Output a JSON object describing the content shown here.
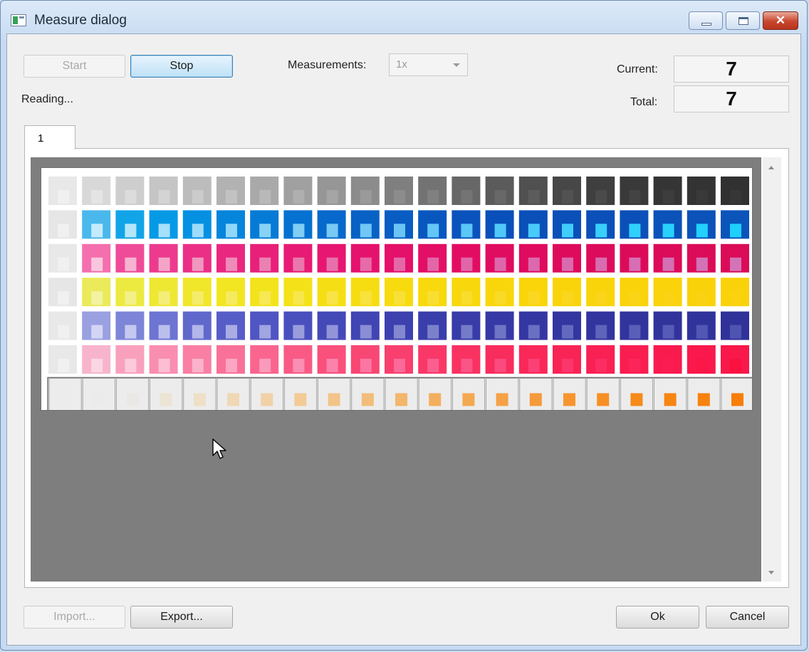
{
  "window": {
    "title": "Measure dialog",
    "icon": "app-window-icon",
    "close_glyph": "✕"
  },
  "controls": {
    "start_label": "Start",
    "stop_label": "Stop",
    "measurements_label": "Measurements:",
    "measurements_value": "1x",
    "status": "Reading...",
    "current_label": "Current:",
    "current_value": "7",
    "total_label": "Total:",
    "total_value": "7"
  },
  "tabs": [
    {
      "label": "1"
    }
  ],
  "footer": {
    "import_label": "Import...",
    "export_label": "Export...",
    "ok_label": "Ok",
    "cancel_label": "Cancel"
  },
  "colors": {
    "viewport_bg": "#7e7e7e",
    "accent_button": "#bfe1f7"
  },
  "patch_chart": {
    "columns": 21,
    "rows": [
      {
        "name": "black",
        "colors": [
          "#e8e8e8",
          "#d8d8d8",
          "#cecece",
          "#c5c5c5",
          "#bcbcbc",
          "#b2b2b2",
          "#a9a9a9",
          "#a0a0a0",
          "#969696",
          "#8c8c8c",
          "#7f7f7f",
          "#737373",
          "#676767",
          "#5b5b5b",
          "#505050",
          "#474747",
          "#3f3f3f",
          "#393939",
          "#353535",
          "#333333",
          "#313131"
        ],
        "inner": [
          "#f0f0f0",
          "#e4e4e4",
          "#dcdcdc",
          "#d4d4d4",
          "#cbcbcb",
          "#c2c2c2",
          "#b9b9b9",
          "#afafaf",
          "#a5a5a5",
          "#9a9a9a",
          "#8c8c8c",
          "#808080",
          "#747474",
          "#686868",
          "#5c5c5c",
          "#525252",
          "#4a4a4a",
          "#434343",
          "#3d3d3d",
          "#393939",
          "#363636"
        ]
      },
      {
        "name": "cyan",
        "colors": [
          "#e6e6e6",
          "#4ab8ec",
          "#12a4e8",
          "#069ae6",
          "#0590e2",
          "#0585dc",
          "#057bd6",
          "#0571d0",
          "#0769cb",
          "#0862c6",
          "#085cc2",
          "#0857bf",
          "#0a53bc",
          "#0a50ba",
          "#0b4fb9",
          "#0b4fb8",
          "#0b4fb8",
          "#0b50b8",
          "#0b52b9",
          "#0b52b9",
          "#0b54ba"
        ],
        "inner": [
          "#f0f0f0",
          "#c4ebfb",
          "#b4e6fa",
          "#a6e0fa",
          "#9cdcf9",
          "#91d7f8",
          "#88d2f6",
          "#80cdf5",
          "#78c9f5",
          "#70c6f4",
          "#6ac5f4",
          "#62c6f6",
          "#5ac7f7",
          "#50c9f8",
          "#48cbf9",
          "#40cdfa",
          "#38cffb",
          "#30d0fc",
          "#28d1fc",
          "#22d1fd",
          "#1ed0fd"
        ]
      },
      {
        "name": "magenta",
        "colors": [
          "#e8e8e8",
          "#f46fae",
          "#ef4b98",
          "#ed3a8e",
          "#eb2f86",
          "#e92780",
          "#e8207a",
          "#e71a75",
          "#e61671",
          "#e5126d",
          "#e41069",
          "#e30e66",
          "#e20d63",
          "#e00c60",
          "#df0b5e",
          "#de0b5c",
          "#dd0b5b",
          "#dc0b5a",
          "#dc0b59",
          "#db0b58",
          "#db0b58"
        ],
        "inner": [
          "#f0f0f0",
          "#f9c6dd",
          "#f6b3d1",
          "#f3a5c8",
          "#f097bf",
          "#ee8bb8",
          "#eb80b2",
          "#e977ad",
          "#e770aa",
          "#e66ba8",
          "#e468a7",
          "#e266a8",
          "#e065a9",
          "#de66ab",
          "#dc68ad",
          "#da6aaf",
          "#d86cb1",
          "#d66eb3",
          "#d470b4",
          "#d372b6",
          "#d274b7"
        ]
      },
      {
        "name": "yellow",
        "colors": [
          "#e6e6e6",
          "#eaea5a",
          "#ecea40",
          "#eee832",
          "#f0e62a",
          "#f2e522",
          "#f3e31c",
          "#f4e118",
          "#f5df14",
          "#f6dd11",
          "#f7db0f",
          "#f8d90d",
          "#f8d70c",
          "#f9d60b",
          "#f9d50a",
          "#fad40a",
          "#fad40a",
          "#fad30a",
          "#fad30a",
          "#fad20a",
          "#fad20a"
        ],
        "inner": [
          "#f0f0f0",
          "#f2f2a0",
          "#f3f088",
          "#f4ee78",
          "#f5ec6a",
          "#f6ea5e",
          "#f7e854",
          "#f7e64c",
          "#f8e444",
          "#f8e23e",
          "#f9e038",
          "#f9de32",
          "#f9dc2c",
          "#f9da26",
          "#fad822",
          "#fad61e",
          "#fad51a",
          "#fad416",
          "#fad314",
          "#fad212",
          "#fad210"
        ]
      },
      {
        "name": "violet",
        "colors": [
          "#e8e8e8",
          "#9aa0e0",
          "#7d85d8",
          "#6d74d2",
          "#6168cc",
          "#575dc7",
          "#4f55c2",
          "#494fbd",
          "#4449b8",
          "#4045b3",
          "#3d41af",
          "#3a3eab",
          "#383ba8",
          "#3639a5",
          "#3437a2",
          "#3336a0",
          "#32359e",
          "#31349c",
          "#31339b",
          "#30339a",
          "#303299"
        ],
        "inner": [
          "#f0f0f0",
          "#d2d5f4",
          "#c5c9f0",
          "#bbbfec",
          "#b2b6e8",
          "#a9ade4",
          "#a1a5e0",
          "#999ddc",
          "#9195d8",
          "#8a8ed4",
          "#8387d0",
          "#7c81cc",
          "#757bc8",
          "#6f75c4",
          "#696fc1",
          "#6369be",
          "#5e64bb",
          "#595fb8",
          "#555bb6",
          "#5157b4",
          "#4e54b2"
        ]
      },
      {
        "name": "red",
        "colors": [
          "#e8e8e8",
          "#f8b4cc",
          "#f9a0bd",
          "#f98eb0",
          "#f97fa4",
          "#f97198",
          "#f9658e",
          "#f95a85",
          "#f9507c",
          "#f94774",
          "#f93f6d",
          "#f93867",
          "#f93262",
          "#f92d5d",
          "#f92859",
          "#f92456",
          "#f92053",
          "#f91d50",
          "#f91b4e",
          "#f9194c",
          "#f9184a"
        ],
        "inner": [
          "#f0f0f0",
          "#fbd6e3",
          "#fbcadb",
          "#fbbed3",
          "#fbb2cb",
          "#fba6c3",
          "#fb9abb",
          "#fb8eb3",
          "#fb82aa",
          "#fb76a2",
          "#fb6a99",
          "#fb5f90",
          "#fb5487",
          "#fb4a7e",
          "#fb4075",
          "#fb366c",
          "#fb2d63",
          "#fb255a",
          "#fb1d51",
          "#fb1648",
          "#fb1040"
        ]
      }
    ],
    "bottom_row": {
      "name": "orange-strip",
      "inner": [
        "#ececec",
        "#ebebeb",
        "#eae8e4",
        "#ece4d4",
        "#eedfc6",
        "#f0d8b4",
        "#f1d2a6",
        "#f2cb96",
        "#f2c488",
        "#f2bd7a",
        "#f3b66c",
        "#f3af5e",
        "#f4a852",
        "#f5a146",
        "#f59a3a",
        "#f6952e",
        "#f68f24",
        "#f68a1a",
        "#f78512",
        "#f7810c",
        "#f77e08"
      ]
    }
  }
}
